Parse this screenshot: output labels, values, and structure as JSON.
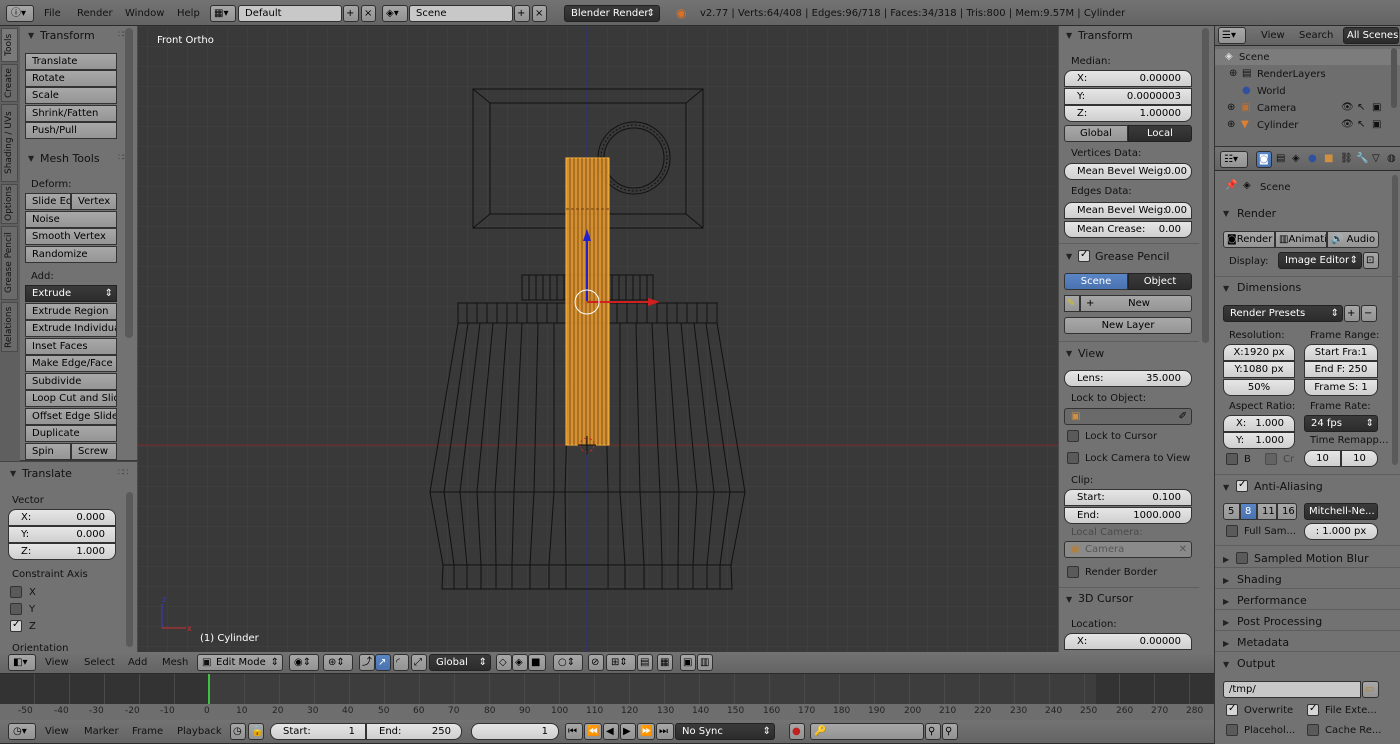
{
  "info_header": {
    "menus": [
      "File",
      "Render",
      "Window",
      "Help"
    ],
    "layout": "Default",
    "scene": "Scene",
    "engine": "Blender Render",
    "stats": "v2.77 | Verts:64/408 | Edges:96/718 | Faces:34/318 | Tris:800 | Mem:9.57M | Cylinder"
  },
  "tool_tabs": [
    "Tools",
    "Create",
    "Shading / UVs",
    "Options",
    "Grease Pencil",
    "Relations"
  ],
  "tools": {
    "transform_title": "Transform",
    "transform": [
      "Translate",
      "Rotate",
      "Scale",
      "Shrink/Fatten",
      "Push/Pull"
    ],
    "mesh_tools_title": "Mesh Tools",
    "deform_label": "Deform:",
    "slide_edge": "Slide Ed",
    "vertex": "Vertex",
    "deform": [
      "Noise",
      "Smooth Vertex",
      "Randomize"
    ],
    "add_label": "Add:",
    "extrude": "Extrude",
    "add": [
      "Extrude Region",
      "Extrude Individual",
      "Inset Faces",
      "Make Edge/Face",
      "Subdivide",
      "Loop Cut and Slide",
      "Offset Edge Slide",
      "Duplicate"
    ],
    "spin": "Spin",
    "screw": "Screw"
  },
  "operator": {
    "title": "Translate",
    "vector_label": "Vector",
    "x_l": "X:",
    "x": "0.000",
    "y_l": "Y:",
    "y": "0.000",
    "z_l": "Z:",
    "z": "1.000",
    "constraint_label": "Constraint Axis",
    "cx": "X",
    "cy": "Y",
    "cz": "Z",
    "orientation": "Orientation"
  },
  "viewport": {
    "view_name": "Front Ortho",
    "object_label": "(1) Cylinder"
  },
  "viewport_header": {
    "menus": [
      "View",
      "Select",
      "Add",
      "Mesh"
    ],
    "mode": "Edit Mode",
    "orientation": "Global"
  },
  "npanel": {
    "transform_title": "Transform",
    "median_label": "Median:",
    "x_l": "X:",
    "x": "0.00000",
    "y_l": "Y:",
    "y": "0.0000003",
    "z_l": "Z:",
    "z": "1.00000",
    "global": "Global",
    "local": "Local",
    "vertices_data": "Vertices Data:",
    "vert_bevel_l": "Mean Bevel Weig:",
    "vert_bevel": "0.00",
    "edges_data": "Edges Data:",
    "edge_bevel_l": "Mean Bevel Weig:",
    "edge_bevel": "0.00",
    "crease_l": "Mean Crease:",
    "crease": "0.00",
    "gp_title": "Grease Pencil",
    "gp_scene": "Scene",
    "gp_object": "Object",
    "gp_new": "New",
    "gp_new_layer": "New Layer",
    "view_title": "View",
    "lens_l": "Lens:",
    "lens": "35.000",
    "lock_object": "Lock to Object:",
    "lock_cursor": "Lock to Cursor",
    "lock_camera": "Lock Camera to View",
    "clip_label": "Clip:",
    "start_l": "Start:",
    "start": "0.100",
    "end_l": "End:",
    "end": "1000.000",
    "local_camera": "Local Camera:",
    "camera": "Camera",
    "render_border": "Render Border",
    "cursor_title": "3D Cursor",
    "location": "Location:",
    "cx_l": "X:",
    "cx": "0.00000"
  },
  "outliner": {
    "view": "View",
    "search": "Search",
    "all_scenes": "All Scenes",
    "items": [
      "Scene",
      "RenderLayers",
      "World",
      "Camera",
      "Cylinder"
    ]
  },
  "properties": {
    "scene": "Scene",
    "render_title": "Render",
    "render_btn": "Render",
    "anim_btn": "Animati",
    "audio_btn": "Audio",
    "display_l": "Display:",
    "display": "Image Editor",
    "dimensions_title": "Dimensions",
    "presets": "Render Presets",
    "resolution": "Resolution:",
    "res_x": "X:1920 px",
    "res_y": "Y:1080 px",
    "res_pct": "50%",
    "frame_range": "Frame Range:",
    "start_frame": "Start Fra:1",
    "end_frame": "End F: 250",
    "frame_step": "Frame S: 1",
    "aspect": "Aspect Ratio:",
    "asp_x_l": "X:",
    "asp_x": "1.000",
    "asp_y_l": "Y:",
    "asp_y": "1.000",
    "frame_rate": "Frame Rate:",
    "fps": "24 fps",
    "remap": "Time Remapp...",
    "remap_old": "10",
    "remap_new": "10",
    "border_b": "B",
    "border_cr": "Cr",
    "aa_title": "Anti-Aliasing",
    "aa_samples": [
      "5",
      "8",
      "11",
      "16"
    ],
    "aa_filter": "Mitchell-Ne...",
    "full_sample": "Full Sam...",
    "filter_size": ": 1.000 px",
    "motion_blur": "Sampled Motion Blur",
    "shading": "Shading",
    "performance": "Performance",
    "post_processing": "Post Processing",
    "metadata": "Metadata",
    "output_title": "Output",
    "output_path": "/tmp/",
    "overwrite": "Overwrite",
    "file_ext": "File Exte...",
    "placeholders": "Placehol...",
    "cache": "Cache Re..."
  },
  "timeline": {
    "ruler": [
      "-50",
      "-40",
      "-30",
      "-20",
      "-10",
      "0",
      "10",
      "20",
      "30",
      "40",
      "50",
      "60",
      "70",
      "80",
      "90",
      "100",
      "110",
      "120",
      "130",
      "140",
      "150",
      "160",
      "170",
      "180",
      "190",
      "200",
      "210",
      "220",
      "230",
      "240",
      "250",
      "260",
      "270",
      "280"
    ],
    "menus": [
      "View",
      "Marker",
      "Frame",
      "Playback"
    ],
    "start_l": "Start:",
    "start": "1",
    "end_l": "End:",
    "end": "250",
    "current": "1",
    "sync": "No Sync"
  },
  "colors": {
    "selection": "#f0a030",
    "x_axis": "#d02020",
    "z_axis": "#3030d0",
    "selected_button": "#5a86c6"
  }
}
